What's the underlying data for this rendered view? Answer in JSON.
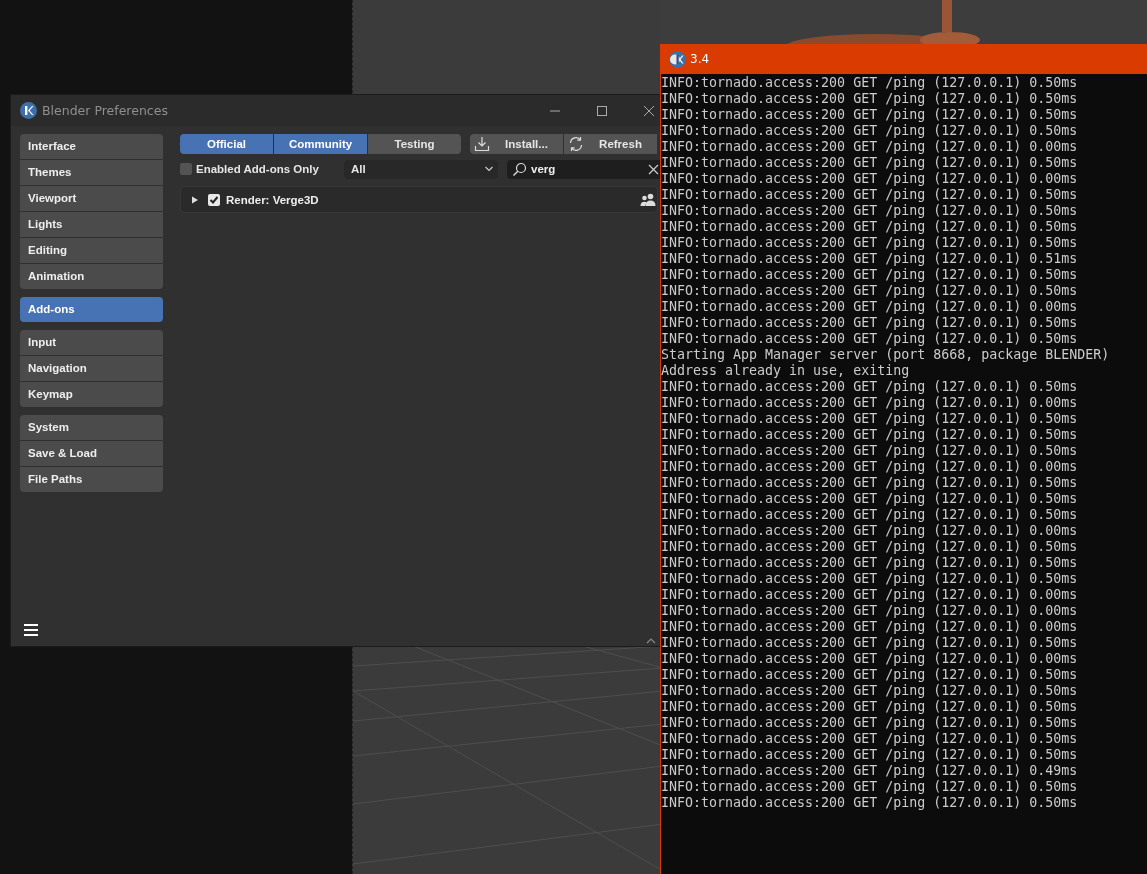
{
  "preferences_window": {
    "title": "Blender Preferences",
    "sidebar": {
      "groups": [
        {
          "items": [
            {
              "label": "Interface",
              "selected": false
            },
            {
              "label": "Themes",
              "selected": false
            },
            {
              "label": "Viewport",
              "selected": false
            },
            {
              "label": "Lights",
              "selected": false
            },
            {
              "label": "Editing",
              "selected": false
            },
            {
              "label": "Animation",
              "selected": false
            }
          ]
        },
        {
          "items": [
            {
              "label": "Add-ons",
              "selected": true
            }
          ]
        },
        {
          "items": [
            {
              "label": "Input",
              "selected": false
            },
            {
              "label": "Navigation",
              "selected": false
            },
            {
              "label": "Keymap",
              "selected": false
            }
          ]
        },
        {
          "items": [
            {
              "label": "System",
              "selected": false
            },
            {
              "label": "Save & Load",
              "selected": false
            },
            {
              "label": "File Paths",
              "selected": false
            }
          ]
        }
      ]
    },
    "tabs": [
      {
        "label": "Official",
        "selected": true
      },
      {
        "label": "Community",
        "selected": true
      },
      {
        "label": "Testing",
        "selected": false
      }
    ],
    "buttons": [
      {
        "label": "Install...",
        "kind": "download"
      },
      {
        "label": "Refresh",
        "kind": "refresh"
      }
    ],
    "enabled_only": {
      "label": "Enabled Add-ons Only",
      "checked": false
    },
    "category": {
      "value": "All"
    },
    "search": {
      "value": "verg"
    },
    "addons": [
      {
        "name": "Render: Verge3D",
        "checked": true,
        "expanded": false
      }
    ]
  },
  "console_window": {
    "title": "3.4",
    "lines": [
      "INFO:tornado.access:200 GET /ping (127.0.0.1) 0.50ms",
      "INFO:tornado.access:200 GET /ping (127.0.0.1) 0.50ms",
      "INFO:tornado.access:200 GET /ping (127.0.0.1) 0.50ms",
      "INFO:tornado.access:200 GET /ping (127.0.0.1) 0.50ms",
      "INFO:tornado.access:200 GET /ping (127.0.0.1) 0.00ms",
      "INFO:tornado.access:200 GET /ping (127.0.0.1) 0.50ms",
      "INFO:tornado.access:200 GET /ping (127.0.0.1) 0.00ms",
      "INFO:tornado.access:200 GET /ping (127.0.0.1) 0.50ms",
      "INFO:tornado.access:200 GET /ping (127.0.0.1) 0.50ms",
      "INFO:tornado.access:200 GET /ping (127.0.0.1) 0.50ms",
      "INFO:tornado.access:200 GET /ping (127.0.0.1) 0.50ms",
      "INFO:tornado.access:200 GET /ping (127.0.0.1) 0.51ms",
      "INFO:tornado.access:200 GET /ping (127.0.0.1) 0.50ms",
      "INFO:tornado.access:200 GET /ping (127.0.0.1) 0.50ms",
      "INFO:tornado.access:200 GET /ping (127.0.0.1) 0.00ms",
      "INFO:tornado.access:200 GET /ping (127.0.0.1) 0.50ms",
      "INFO:tornado.access:200 GET /ping (127.0.0.1) 0.50ms",
      "Starting App Manager server (port 8668, package BLENDER)",
      "Address already in use, exiting",
      "INFO:tornado.access:200 GET /ping (127.0.0.1) 0.50ms",
      "INFO:tornado.access:200 GET /ping (127.0.0.1) 0.00ms",
      "INFO:tornado.access:200 GET /ping (127.0.0.1) 0.50ms",
      "INFO:tornado.access:200 GET /ping (127.0.0.1) 0.50ms",
      "INFO:tornado.access:200 GET /ping (127.0.0.1) 0.50ms",
      "INFO:tornado.access:200 GET /ping (127.0.0.1) 0.00ms",
      "INFO:tornado.access:200 GET /ping (127.0.0.1) 0.50ms",
      "INFO:tornado.access:200 GET /ping (127.0.0.1) 0.50ms",
      "INFO:tornado.access:200 GET /ping (127.0.0.1) 0.50ms",
      "INFO:tornado.access:200 GET /ping (127.0.0.1) 0.00ms",
      "INFO:tornado.access:200 GET /ping (127.0.0.1) 0.50ms",
      "INFO:tornado.access:200 GET /ping (127.0.0.1) 0.50ms",
      "INFO:tornado.access:200 GET /ping (127.0.0.1) 0.50ms",
      "INFO:tornado.access:200 GET /ping (127.0.0.1) 0.00ms",
      "INFO:tornado.access:200 GET /ping (127.0.0.1) 0.00ms",
      "INFO:tornado.access:200 GET /ping (127.0.0.1) 0.00ms",
      "INFO:tornado.access:200 GET /ping (127.0.0.1) 0.50ms",
      "INFO:tornado.access:200 GET /ping (127.0.0.1) 0.00ms",
      "INFO:tornado.access:200 GET /ping (127.0.0.1) 0.50ms",
      "INFO:tornado.access:200 GET /ping (127.0.0.1) 0.50ms",
      "INFO:tornado.access:200 GET /ping (127.0.0.1) 0.50ms",
      "INFO:tornado.access:200 GET /ping (127.0.0.1) 0.50ms",
      "INFO:tornado.access:200 GET /ping (127.0.0.1) 0.50ms",
      "INFO:tornado.access:200 GET /ping (127.0.0.1) 0.50ms",
      "INFO:tornado.access:200 GET /ping (127.0.0.1) 0.49ms",
      "INFO:tornado.access:200 GET /ping (127.0.0.1) 0.50ms",
      "INFO:tornado.access:200 GET /ping (127.0.0.1) 0.50ms"
    ]
  }
}
